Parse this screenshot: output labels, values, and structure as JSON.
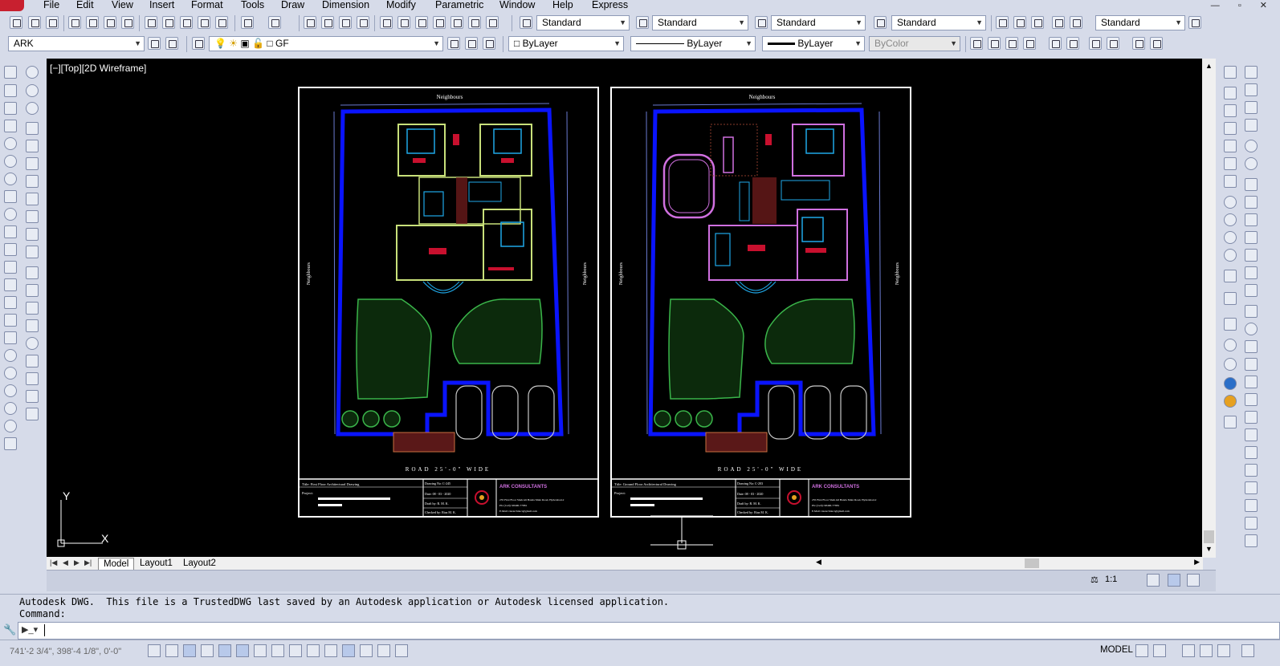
{
  "menu": {
    "items": [
      "File",
      "Edit",
      "View",
      "Insert",
      "Format",
      "Tools",
      "Draw",
      "Dimension",
      "Modify",
      "Parametric",
      "Window",
      "Help",
      "Express"
    ]
  },
  "toolbar1": {
    "text_style": "Standard",
    "dim_style": "Standard",
    "table_style": "Standard",
    "mleader_style": "Standard",
    "multileader_scale": "Standard"
  },
  "toolbar2": {
    "workspace": "ARK",
    "layer": "GF",
    "color": "ByLayer",
    "linetype": "ByLayer",
    "lineweight": "ByLayer",
    "plotstyle": "ByColor"
  },
  "viewport": {
    "label": "[−][Top][2D Wireframe]"
  },
  "sheet_left": {
    "top_label": "Neighbours",
    "left_label": "Neighbours",
    "right_label": "Neighbours",
    "road": "ROAD 25'-0\" WIDE",
    "title_label": "Title: First Floor Architectural Drawing",
    "project_label": "Project:",
    "drawing_no": "Drawing No: C-245",
    "date": "Date: 08 - 03 - 2020",
    "draft": "Draft by: R. M. K.",
    "checked": "Checked by: Riaz M. K.",
    "firm": "ARK CONSULTANTS",
    "address": "255 First Floor Shah Ali Banda Main Road, Hyderabad-2",
    "phone": "Ph: (Cell): 98490-77881",
    "email": "E.Mail: riazarchitect@gmail.com"
  },
  "sheet_right": {
    "top_label": "Neighbours",
    "left_label": "Neighbours",
    "right_label": "Neighbours",
    "road": "ROAD 25'-0\" WIDE",
    "title_label": "Title: Ground Floor Architectural Drawing",
    "project_label": "Project:",
    "drawing_no": "Drawing No: C-203",
    "date": "Date: 08 - 03 - 2020",
    "draft": "Draft by: R. M. K.",
    "checked": "Checked by: Riaz M. K.",
    "firm": "ARK CONSULTANTS",
    "address": "255 First Floor Shah Ali Banda Main Road, Hyderabad-2",
    "phone": "Ph: (Cell): 98490-77881",
    "email": "E.Mail: riazarchitect@gmail.com"
  },
  "ucs": {
    "x": "X",
    "y": "Y"
  },
  "tabs": [
    "Model",
    "Layout1",
    "Layout2"
  ],
  "annotation": {
    "scale": "1:1"
  },
  "command": {
    "history": "Autodesk DWG.  This file is a TrustedDWG last saved by an Autodesk application or Autodesk licensed application.",
    "prompt": "Command:"
  },
  "status": {
    "coords": "741'-2 3/4\", 398'-4 1/8\", 0'-0\"",
    "space": "MODEL"
  },
  "colors": {
    "canvas": "#000000",
    "plot_boundary": "#0a14ff",
    "walls": "#c8e07a",
    "furniture": "#1fa8e8",
    "furniture_red": "#c8102e",
    "trees": "#3ab54a",
    "sheet_border": "#ffffff",
    "magenta": "#d070e0"
  },
  "icons": {
    "top_toolbar": [
      "new-icon",
      "open-icon",
      "save-icon",
      "plot-icon",
      "preview-icon",
      "publish-icon",
      "3dprint-icon",
      "cut-icon",
      "copy-icon",
      "paste-icon",
      "matchprop-icon",
      "undo-icon",
      "redo-icon",
      "pan-icon",
      "zoom-realtime-icon",
      "zoom-window-icon",
      "zoom-previous-icon",
      "properties-icon",
      "designcenter-icon",
      "toolpalettes-icon",
      "sheetset-icon",
      "markup-icon",
      "quickcalc-icon"
    ]
  }
}
